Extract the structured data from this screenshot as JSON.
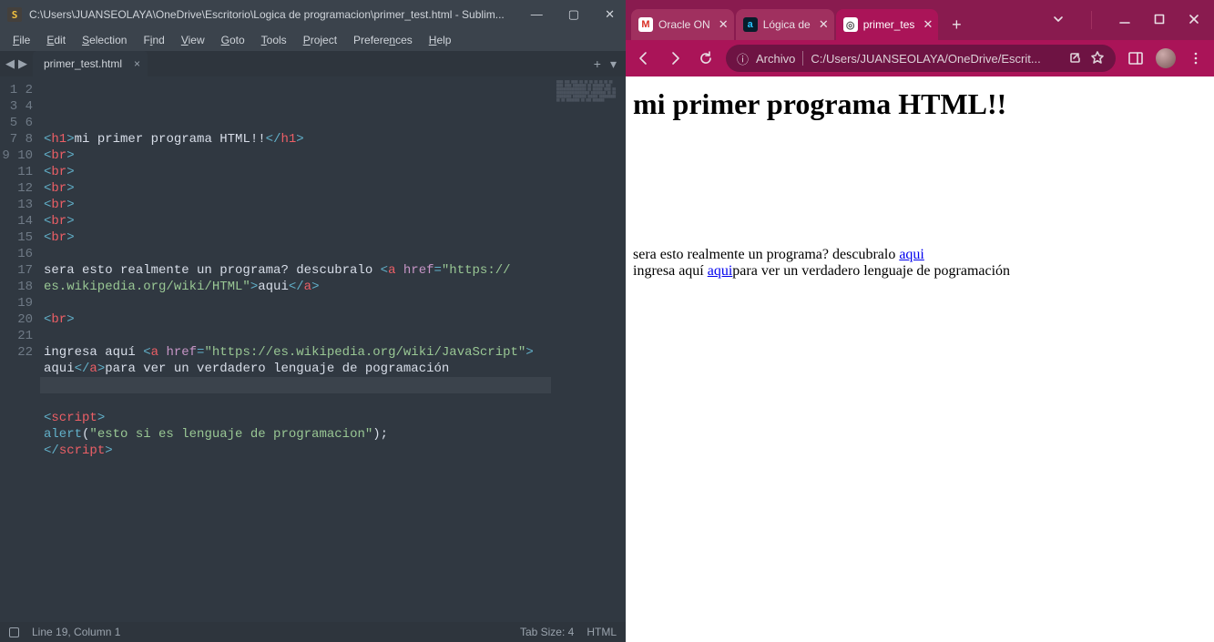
{
  "sublime": {
    "title": "C:\\Users\\JUANSEOLAYA\\OneDrive\\Escritorio\\Logica de programacion\\primer_test.html - Sublim...",
    "menu": [
      "File",
      "Edit",
      "Selection",
      "Find",
      "View",
      "Goto",
      "Tools",
      "Project",
      "Preferences",
      "Help"
    ],
    "tab_name": "primer_test.html",
    "status": {
      "cursor": "Line 19, Column 1",
      "tabsize": "Tab Size: 4",
      "syntax": "HTML"
    },
    "line_count": 22,
    "code": {
      "l1_a": "h1",
      "l1_txt": "mi primer programa HTML!!",
      "l1_b": "h1",
      "br": "br",
      "l9_pre": "sera esto realmente un programa? descubralo ",
      "l9_tag": "a",
      "l9_attr": "href",
      "l9_url": "\"https://es.wikipedia.org/wiki/HTML\"",
      "l9_link": "aqui",
      "l13_pre": "ingresa aquí ",
      "l13_url": "\"https://es.wikipedia.org/wiki/JavaScript\"",
      "l13_link": "aqui",
      "l13_post": "para ver un verdadero lenguaje de pogramación",
      "l16": "script",
      "l17_fn": "alert",
      "l17_arg": "\"esto si es lenguaje de programacion\"",
      "l18": "script"
    }
  },
  "chrome": {
    "tabs": [
      {
        "label": "Oracle ON",
        "favicon_text": "M",
        "favicon_bg": "#fff",
        "favicon_fg": "#d93025",
        "active": false
      },
      {
        "label": "Lógica de",
        "favicon_text": "a",
        "favicon_bg": "#071d2b",
        "favicon_fg": "#2cc3ff",
        "active": false
      },
      {
        "label": "primer_tes",
        "favicon_text": "◎",
        "favicon_bg": "#fff",
        "favicon_fg": "#555",
        "active": true
      }
    ],
    "omnibox_label": "Archivo",
    "omnibox_url": "C:/Users/JUANSEOLAYA/OneDrive/Escrit...",
    "page": {
      "h1": "mi primer programa HTML!!",
      "p1_pre": "sera esto realmente un programa? descubralo ",
      "p1_link": "aqui",
      "p2_pre": "ingresa aquí ",
      "p2_link": "aqui",
      "p2_post": "para ver un verdadero lenguaje de pogramación"
    }
  }
}
